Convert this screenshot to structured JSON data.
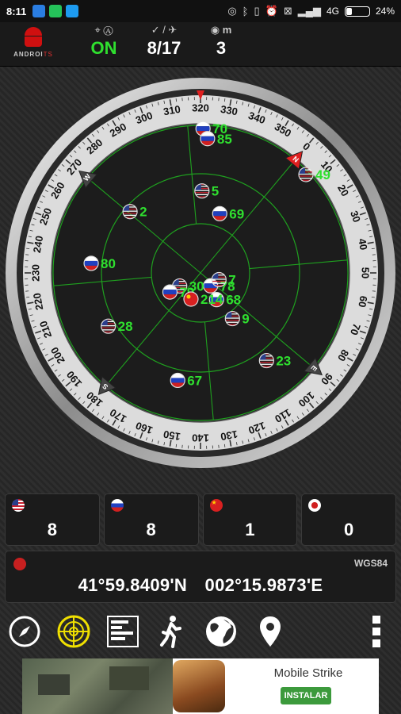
{
  "status_bar": {
    "time": "8:11",
    "network": "4G",
    "battery": "24%",
    "battery_level": 0.24
  },
  "header": {
    "logo_text_a": "ANDROI",
    "logo_text_b": "TS",
    "gps_status": "ON",
    "satellites_used": "8",
    "satellites_sep": "/",
    "satellites_visible": "17",
    "accuracy_unit": "m",
    "accuracy_value": "3"
  },
  "compass": {
    "heading_deg": 320,
    "degree_labels": [
      "0",
      "10",
      "20",
      "30",
      "40",
      "50",
      "60",
      "70",
      "80",
      "90",
      "100",
      "110",
      "120",
      "130",
      "140",
      "150",
      "160",
      "170",
      "180",
      "190",
      "200",
      "210",
      "220",
      "230",
      "240",
      "250",
      "260",
      "270",
      "280",
      "290",
      "300",
      "310",
      "320",
      "330",
      "340",
      "350"
    ],
    "cardinals": [
      "N",
      "E",
      "S",
      "W"
    ]
  },
  "satellites": [
    {
      "id": "70",
      "flag": "ru",
      "az": 321,
      "el": 2
    },
    {
      "id": "85",
      "flag": "ru",
      "az": 323,
      "el": 8
    },
    {
      "id": "49",
      "flag": "us",
      "az": 7,
      "el": 2
    },
    {
      "id": "5",
      "flag": "us",
      "az": 321,
      "el": 40
    },
    {
      "id": "69",
      "flag": "ru",
      "az": 338,
      "el": 52
    },
    {
      "id": "2",
      "flag": "us",
      "az": 271,
      "el": 33
    },
    {
      "id": "78",
      "flag": "ru",
      "az": 102,
      "el": 80
    },
    {
      "id": "7",
      "flag": "us",
      "az": 70,
      "el": 78
    },
    {
      "id": "30",
      "flag": "us",
      "az": 198,
      "el": 75
    },
    {
      "id": "68",
      "flag": "ru",
      "az": 109,
      "el": 71
    },
    {
      "id": "9",
      "flag": "us",
      "az": 105,
      "el": 56
    },
    {
      "id": "79",
      "flag": "ru",
      "az": 198,
      "el": 68
    },
    {
      "id": "214",
      "flag": "cn",
      "az": 160,
      "el": 73
    },
    {
      "id": "23",
      "flag": "us",
      "az": 103,
      "el": 23
    },
    {
      "id": "80",
      "flag": "ru",
      "az": 235,
      "el": 23
    },
    {
      "id": "67",
      "flag": "ru",
      "az": 152,
      "el": 23
    },
    {
      "id": "28",
      "flag": "us",
      "az": 200,
      "el": 25
    }
  ],
  "constellations": [
    {
      "name": "gps",
      "flag": "us",
      "count": "8"
    },
    {
      "name": "glonass",
      "flag": "ru",
      "count": "8"
    },
    {
      "name": "beidou",
      "flag": "cn",
      "count": "1"
    },
    {
      "name": "qzss",
      "flag": "jp",
      "count": "0"
    }
  ],
  "location": {
    "datum": "WGS84",
    "latitude": "41°59.8409'N",
    "longitude": "002°15.9873'E"
  },
  "toolbar": [
    "compass-icon",
    "radar-icon",
    "chart-icon",
    "walk-icon",
    "globe-icon",
    "map-pin-icon",
    "more-icon"
  ],
  "ad": {
    "title": "Mobile Strike",
    "button": "INSTALAR"
  },
  "colors": {
    "accent_green": "#2fe02f",
    "radar_grid": "#1fa01f",
    "logo_red": "#d01010"
  }
}
